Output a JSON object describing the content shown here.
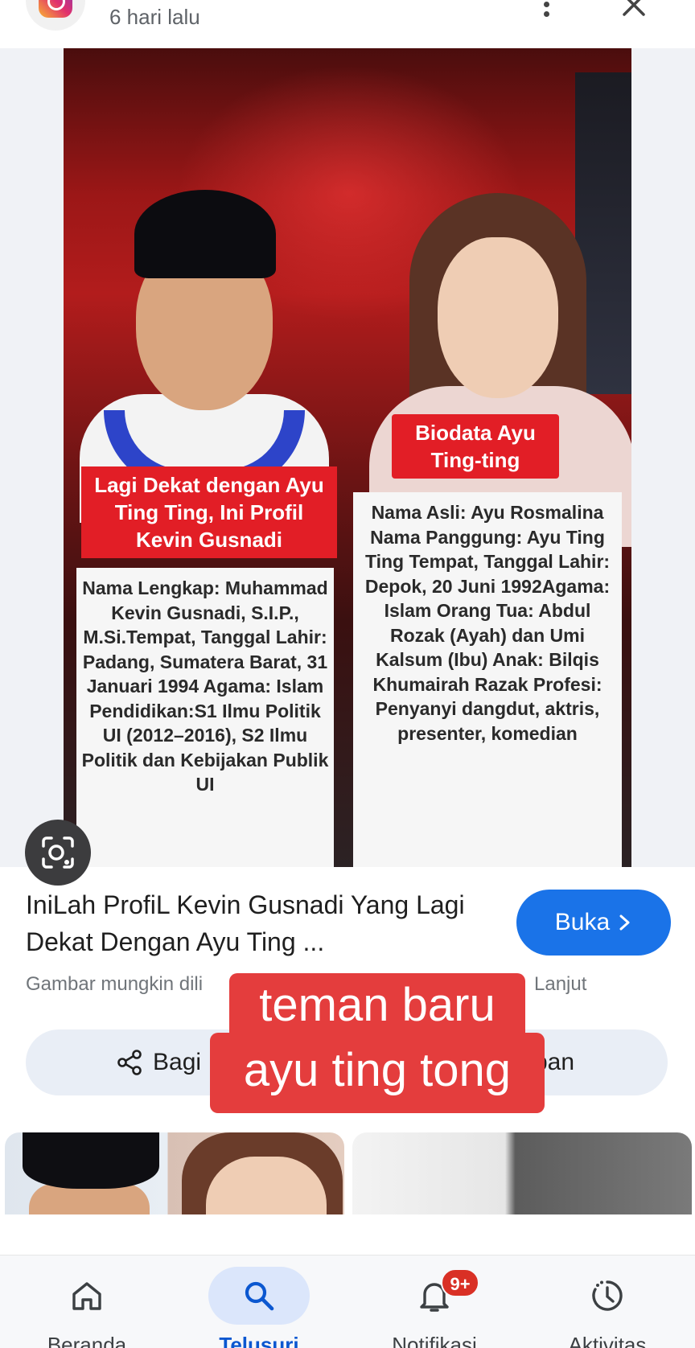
{
  "header": {
    "time_ago": "6 hari lalu",
    "app_icon": "instagram-icon",
    "more_icon": "more-vert-icon",
    "close_icon": "close-icon"
  },
  "image": {
    "man_tag": "Lagi Dekat dengan Ayu Ting Ting, Ini Profil Kevin Gusnadi",
    "man_card": "Nama Lengkap: Muhammad Kevin Gusnadi, S.I.P., M.Si.Tempat, Tanggal Lahir: Padang, Sumatera Barat, 31 Januari 1994 Agama: Islam Pendidikan:S1 Ilmu Politik UI (2012–2016), S2 Ilmu Politik dan Kebijakan Publik UI",
    "woman_tag": "Biodata Ayu Ting-ting",
    "woman_card": "Nama Asli: Ayu Rosmalina Nama Panggung: Ayu Ting Ting Tempat, Tanggal Lahir: Depok, 20 Juni 1992Agama: Islam Orang Tua: Abdul Rozak (Ayah) dan Umi Kalsum (Ibu) Anak: Bilqis Khumairah Razak Profesi: Penyanyi dangdut, aktris, presenter, komedian",
    "lens_icon": "google-lens-icon"
  },
  "result": {
    "title": "IniLah ProfiL Kevin Gusnadi Yang Lagi Dekat Dengan Ayu Ting ...",
    "open_label": "Buka",
    "open_icon": "chevron-right-icon",
    "caption_left": "Gambar mungkin dili",
    "caption_right": "Lanjut"
  },
  "actions": {
    "share_label": "Bagi",
    "share_icon": "share-icon",
    "save_label": "pan"
  },
  "overlay": {
    "line1": "teman baru",
    "line2": "ayu ting tong"
  },
  "nav": {
    "items": [
      {
        "label": "Beranda",
        "icon": "home-icon",
        "active": false
      },
      {
        "label": "Telusuri",
        "icon": "search-icon",
        "active": true
      },
      {
        "label": "Notifikasi",
        "icon": "bell-icon",
        "active": false,
        "badge": "9+"
      },
      {
        "label": "Aktivitas",
        "icon": "activity-icon",
        "active": false
      }
    ]
  },
  "colors": {
    "accent": "#1a73e8",
    "overlay_red": "#e43d3d",
    "tag_red": "#e21e26",
    "badge_red": "#d93025",
    "active_nav": "#0b57d0"
  }
}
